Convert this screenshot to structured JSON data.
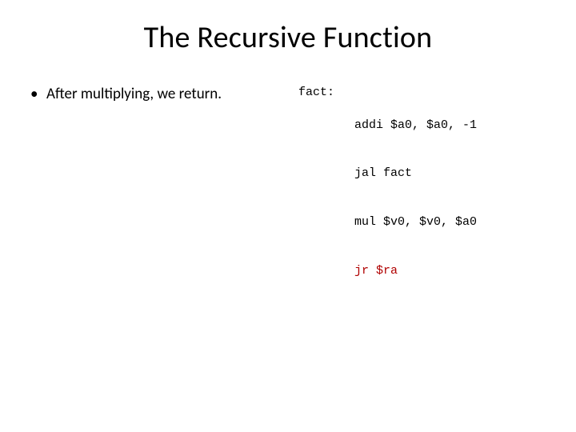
{
  "title": "The Recursive Function",
  "bullet": {
    "marker": "•",
    "text": "After multiplying, we return."
  },
  "code": {
    "label": "fact:",
    "lines": {
      "l1": "addi $a0, $a0, -1",
      "l2": "jal fact",
      "l3": "mul $v0, $v0, $a0",
      "l4": "jr $ra"
    }
  }
}
